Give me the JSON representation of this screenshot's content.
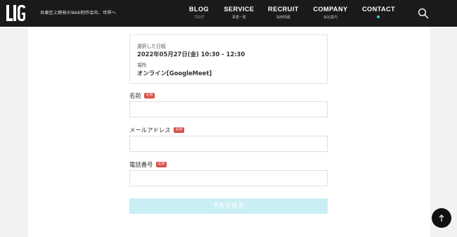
{
  "header": {
    "logo_text": "LIG",
    "tagline": "台東区上野発のWeb制作会社、世界へ",
    "nav": [
      {
        "label": "BLOG",
        "sub": "ブログ"
      },
      {
        "label": "SERVICE",
        "sub": "事業一覧"
      },
      {
        "label": "RECRUIT",
        "sub": "採用情報"
      },
      {
        "label": "COMPANY",
        "sub": "会社案内"
      },
      {
        "label": "CONTACT",
        "sub": ""
      }
    ],
    "active_nav": "CONTACT",
    "search_icon": "search-icon"
  },
  "booking": {
    "date_label": "選択した日程",
    "date_value": "2022年05月27日(金) 10:30 - 12:30",
    "place_label": "場所",
    "place_value": "オンライン[GoogleMeet]"
  },
  "form": {
    "required_badge": "必須",
    "name_label": "名前",
    "name_value": "",
    "email_label": "メールアドレス",
    "email_value": "",
    "phone_label": "電話番号",
    "phone_value": "",
    "submit_label": "予約を確定"
  },
  "scroll_top_icon": "arrow-up-icon",
  "colors": {
    "header_bg": "#1a1a1a",
    "accent": "#3cc3d6",
    "required": "#d9504a",
    "submit_disabled": "#c9eef3"
  }
}
